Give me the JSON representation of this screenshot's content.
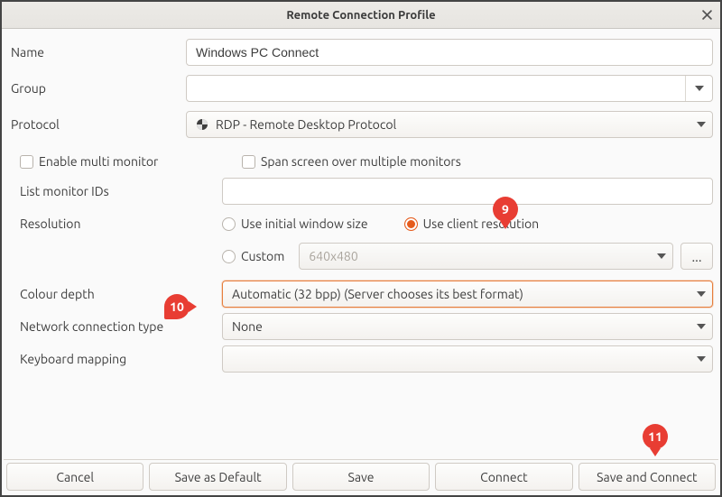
{
  "window": {
    "title": "Remote Connection Profile"
  },
  "fields": {
    "name_label": "Name",
    "name_value": "Windows PC Connect",
    "group_label": "Group",
    "group_value": "",
    "protocol_label": "Protocol",
    "protocol_value": "RDP - Remote Desktop Protocol"
  },
  "opts": {
    "enable_multi_monitor": "Enable multi monitor",
    "span_screen": "Span screen over multiple monitors",
    "list_monitor_ids_label": "List monitor IDs",
    "list_monitor_ids_value": "",
    "resolution_label": "Resolution",
    "res_initial": "Use initial window size",
    "res_client": "Use client resolution",
    "res_custom": "Custom",
    "res_custom_value": "640x480",
    "more": "...",
    "colour_depth_label": "Colour depth",
    "colour_depth_value": "Automatic (32 bpp) (Server chooses its best format)",
    "net_type_label": "Network connection type",
    "net_type_value": "None",
    "kbd_label": "Keyboard mapping",
    "kbd_value": ""
  },
  "buttons": {
    "cancel": "Cancel",
    "save_default": "Save as Default",
    "save": "Save",
    "connect": "Connect",
    "save_and_connect": "Save and Connect"
  },
  "annotations": {
    "b9": "9",
    "b10": "10",
    "b11": "11"
  }
}
